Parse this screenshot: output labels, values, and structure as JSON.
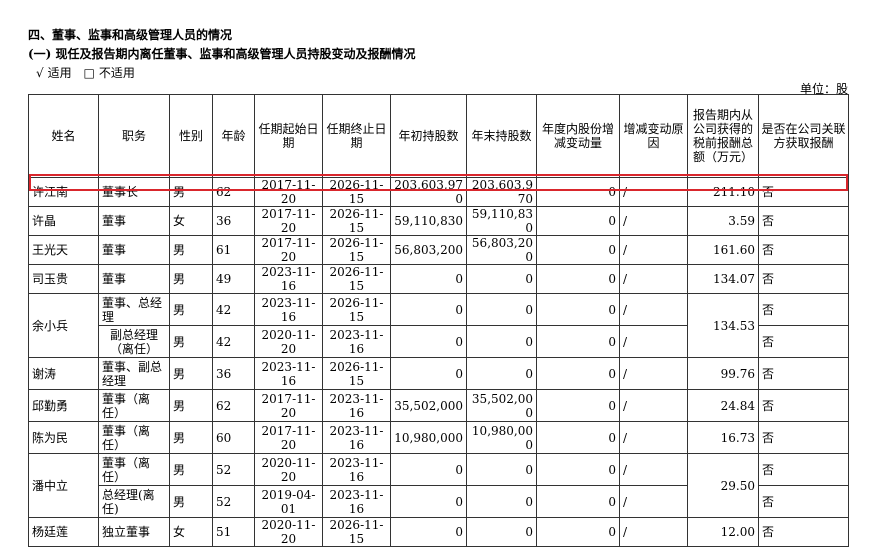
{
  "heading": "四、董事、监事和高级管理人员的情况",
  "subheading": "(一)  现任及报告期内离任董事、监事和高级管理人员持股变动及报酬情况",
  "applicable": {
    "yes_mark": "√",
    "yes_label": "适用",
    "no_mark": "□",
    "no_label": "不适用"
  },
  "unit": "单位：股",
  "columns": [
    "姓名",
    "职务",
    "性别",
    "年龄",
    "任期起始日期",
    "任期终止日期",
    "年初持股数",
    "年末持股数",
    "年度内股份增减变动量",
    "增减变动原因",
    "报告期内从公司获得的税前报酬总额（万元）",
    "是否在公司关联方获取报酬"
  ],
  "rows": [
    {
      "name": "许江南",
      "role": "董事长",
      "sex": "男",
      "age": "62",
      "start": "2017-11-20",
      "end": "2026-11-15",
      "begin_shares": "203,603,970",
      "end_shares": "203,603,970",
      "change": "0",
      "reason": "/",
      "pay": "211.10",
      "related": "否"
    },
    {
      "name": "许晶",
      "role": "董事",
      "sex": "女",
      "age": "36",
      "start": "2017-11-20",
      "end": "2026-11-15",
      "begin_shares": "59,110,830",
      "end_shares": "59,110,830",
      "change": "0",
      "reason": "/",
      "pay": "3.59",
      "related": "否"
    },
    {
      "name": "王光天",
      "role": "董事",
      "sex": "男",
      "age": "61",
      "start": "2017-11-20",
      "end": "2026-11-15",
      "begin_shares": "56,803,200",
      "end_shares": "56,803,200",
      "change": "0",
      "reason": "/",
      "pay": "161.60",
      "related": "否"
    },
    {
      "name": "司玉贵",
      "role": "董事",
      "sex": "男",
      "age": "49",
      "start": "2023-11-16",
      "end": "2026-11-15",
      "begin_shares": "0",
      "end_shares": "0",
      "change": "0",
      "reason": "/",
      "pay": "134.07",
      "related": "否"
    },
    {
      "name": "余小兵",
      "role": "董事、总经理",
      "sex": "男",
      "age": "42",
      "start": "2023-11-16",
      "end": "2026-11-15",
      "begin_shares": "0",
      "end_shares": "0",
      "change": "0",
      "reason": "/",
      "pay": "134.53",
      "related": "否"
    },
    {
      "role": "副总经理（离任）",
      "sex": "男",
      "age": "42",
      "start": "2020-11-20",
      "end": "2023-11-16",
      "begin_shares": "0",
      "end_shares": "0",
      "change": "0",
      "reason": "/",
      "related": "否"
    },
    {
      "name": "谢涛",
      "role": "董事、副总经理",
      "sex": "男",
      "age": "36",
      "start": "2023-11-16",
      "end": "2026-11-15",
      "begin_shares": "0",
      "end_shares": "0",
      "change": "0",
      "reason": "/",
      "pay": "99.76",
      "related": "否"
    },
    {
      "name": "邱勤勇",
      "role": "董事（离任）",
      "sex": "男",
      "age": "62",
      "start": "2017-11-20",
      "end": "2023-11-16",
      "begin_shares": "35,502,000",
      "end_shares": "35,502,000",
      "change": "0",
      "reason": "/",
      "pay": "24.84",
      "related": "否"
    },
    {
      "name": "陈为民",
      "role": "董事（离任）",
      "sex": "男",
      "age": "60",
      "start": "2017-11-20",
      "end": "2023-11-16",
      "begin_shares": "10,980,000",
      "end_shares": "10,980,000",
      "change": "0",
      "reason": "/",
      "pay": "16.73",
      "related": "否"
    },
    {
      "name": "潘中立",
      "role": "董事（离任）",
      "sex": "男",
      "age": "52",
      "start": "2020-11-20",
      "end": "2023-11-16",
      "begin_shares": "0",
      "end_shares": "0",
      "change": "0",
      "reason": "/",
      "pay": "29.50",
      "related": "否"
    },
    {
      "role": "总经理(离任)",
      "sex": "男",
      "age": "52",
      "start": "2019-04-01",
      "end": "2023-11-16",
      "begin_shares": "0",
      "end_shares": "0",
      "change": "0",
      "reason": "/",
      "related": "否"
    },
    {
      "name": "杨廷莲",
      "role": "独立董事",
      "sex": "女",
      "age": "51",
      "start": "2020-11-20",
      "end": "2026-11-15",
      "begin_shares": "0",
      "end_shares": "0",
      "change": "0",
      "reason": "/",
      "pay": "12.00",
      "related": "否"
    }
  ]
}
